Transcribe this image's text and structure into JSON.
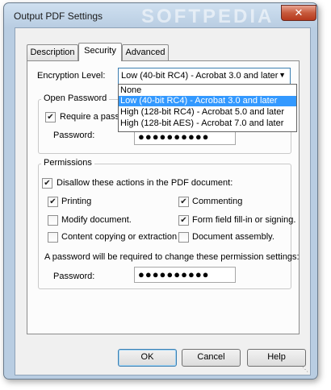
{
  "window": {
    "title": "Output PDF Settings",
    "watermark": "SOFTPEDIA",
    "close_glyph": "✕"
  },
  "tabs": [
    {
      "label": "Description"
    },
    {
      "label": "Security"
    },
    {
      "label": "Advanced"
    }
  ],
  "encryption": {
    "label": "Encryption Level:",
    "value": "Low (40-bit RC4) - Acrobat 3.0 and later",
    "options": [
      "None",
      "Low (40-bit RC4) - Acrobat 3.0 and later",
      "High (128-bit RC4) - Acrobat 5.0 and later",
      "High (128-bit AES) - Acrobat 7.0 and later"
    ],
    "selected_index": 1
  },
  "open_password": {
    "title": "Open Password",
    "require_label": "Require a pass",
    "require_checked": true,
    "password_label": "Password:",
    "password_value": "●●●●●●●●●●"
  },
  "permissions": {
    "title": "Permissions",
    "disallow_label": "Disallow these actions in the PDF document:",
    "disallow_checked": true,
    "actions": [
      {
        "label": "Printing",
        "checked": true
      },
      {
        "label": "Commenting",
        "checked": true
      },
      {
        "label": "Modify document.",
        "checked": false
      },
      {
        "label": "Form field fill-in or signing.",
        "checked": true
      },
      {
        "label": "Content copying or extraction",
        "checked": false
      },
      {
        "label": "Document assembly.",
        "checked": false
      }
    ],
    "note": "A password will be required to change these permission settings:",
    "password_label": "Password:",
    "password_value": "●●●●●●●●●●"
  },
  "buttons": {
    "ok": "OK",
    "cancel": "Cancel",
    "help": "Help"
  },
  "check_glyph": "✔"
}
